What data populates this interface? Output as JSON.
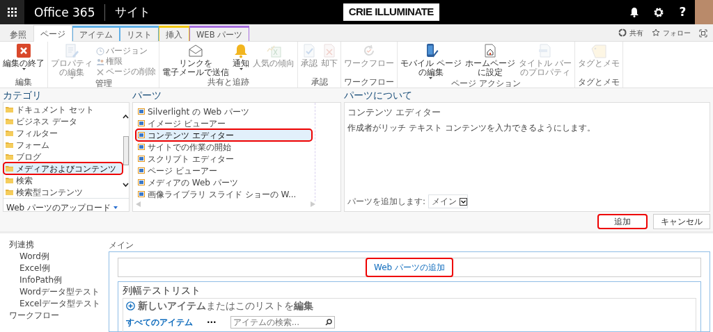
{
  "top_bar": {
    "app_title": "Office 365",
    "site_title": "サイト",
    "logo_text": "CRIE ILLUMINATE",
    "help_label": "?"
  },
  "tabs": [
    {
      "label": "参照",
      "selected": false
    },
    {
      "label": "ページ",
      "selected": true
    },
    {
      "label": "アイテム",
      "selected": false,
      "color": "#5fb0e8"
    },
    {
      "label": "リスト",
      "selected": false,
      "color": "#5fb0e8"
    },
    {
      "label": "挿入",
      "selected": false,
      "color": "#f2c811"
    },
    {
      "label": "WEB パーツ",
      "selected": false,
      "color": "#a86fe0"
    }
  ],
  "page_actions": [
    {
      "label": "共有"
    },
    {
      "label": "フォロー"
    }
  ],
  "ribbon": [
    {
      "label": "編集",
      "buttons": [
        {
          "kind": "large",
          "lines": [
            "編集の終了"
          ],
          "disabled": false,
          "dropdown": true
        }
      ]
    },
    {
      "label": "管理",
      "buttons": [
        {
          "kind": "large",
          "lines": [
            "プロパティ",
            "の編集"
          ],
          "disabled": true,
          "dropdown": true
        },
        {
          "kind": "small",
          "label": "バージョン",
          "disabled": true
        },
        {
          "kind": "small",
          "label": "権限",
          "disabled": true
        },
        {
          "kind": "small",
          "label": "ページの削除",
          "disabled": true
        }
      ]
    },
    {
      "label": "共有と追跡",
      "buttons": [
        {
          "kind": "large",
          "lines": [
            "リンクを",
            "電子メールで送信"
          ],
          "disabled": false
        },
        {
          "kind": "large",
          "lines": [
            "通知"
          ],
          "disabled": false,
          "dropdown": true
        },
        {
          "kind": "large",
          "lines": [
            "人気の傾向"
          ],
          "disabled": true
        }
      ]
    },
    {
      "label": "承認",
      "buttons": [
        {
          "kind": "large",
          "lines": [
            "承認"
          ],
          "disabled": true
        },
        {
          "kind": "large",
          "lines": [
            "却下"
          ],
          "disabled": true
        }
      ]
    },
    {
      "label": "ワークフロー",
      "buttons": [
        {
          "kind": "large",
          "lines": [
            "ワークフロー"
          ],
          "disabled": true
        }
      ]
    },
    {
      "label": "ページ アクション",
      "buttons": [
        {
          "kind": "large",
          "lines": [
            "モバイル ページ",
            "の編集"
          ],
          "disabled": false,
          "dropdown": true
        },
        {
          "kind": "large",
          "lines": [
            "ホームページ",
            "に設定"
          ],
          "disabled": false
        },
        {
          "kind": "large",
          "lines": [
            "タイトル バー",
            "のプロパティ"
          ],
          "disabled": true
        }
      ]
    },
    {
      "label": "タグとメモ",
      "buttons": [
        {
          "kind": "large",
          "lines": [
            "タグとメモ"
          ],
          "disabled": true
        }
      ]
    }
  ],
  "web_part_picker": {
    "categories_heading": "カテゴリ",
    "categories": [
      {
        "label": "ドキュメント セット",
        "selected": false,
        "highlighted": false
      },
      {
        "label": "ビジネス データ",
        "selected": false,
        "highlighted": false
      },
      {
        "label": "フィルター",
        "selected": false,
        "highlighted": false
      },
      {
        "label": "フォーム",
        "selected": false,
        "highlighted": false
      },
      {
        "label": "ブログ",
        "selected": false,
        "highlighted": false
      },
      {
        "label": "メディアおよびコンテンツ",
        "selected": true,
        "highlighted": true
      },
      {
        "label": "検索",
        "selected": false,
        "highlighted": false
      },
      {
        "label": "検索型コンテンツ",
        "selected": false,
        "highlighted": false
      }
    ],
    "upload_link": "Web パーツのアップロード",
    "parts_heading": "パーツ",
    "parts": [
      {
        "label": "Silverlight の Web パーツ",
        "selected": false,
        "highlighted": false
      },
      {
        "label": "イメージ ビューアー",
        "selected": false,
        "highlighted": false
      },
      {
        "label": "コンテンツ エディター",
        "selected": true,
        "highlighted": true
      },
      {
        "label": "サイトでの作業の開始",
        "selected": false,
        "highlighted": false
      },
      {
        "label": "スクリプト エディター",
        "selected": false,
        "highlighted": false
      },
      {
        "label": "ページ ビューアー",
        "selected": false,
        "highlighted": false
      },
      {
        "label": "メディアの Web パーツ",
        "selected": false,
        "highlighted": false
      },
      {
        "label": "画像ライブラリ スライド ショーの W...",
        "selected": false,
        "highlighted": false
      }
    ],
    "about_heading": "パーツについて",
    "about_title": "コンテンツ エディター",
    "about_description": "作成者がリッチ テキスト コンテンツを入力できるようにします。",
    "zone_label": "パーツを追加します:",
    "zone_value": "メイン",
    "add_button": {
      "label": "追加",
      "highlighted": true
    },
    "cancel_button": {
      "label": "キャンセル",
      "highlighted": false
    }
  },
  "quick_launch": [
    {
      "label": "列連携",
      "children": [
        {
          "label": "Word例"
        },
        {
          "label": "Excel例"
        },
        {
          "label": "InfoPath例"
        },
        {
          "label": "Wordデータ型テスト"
        },
        {
          "label": "Excelデータ型テスト"
        }
      ]
    },
    {
      "label": "ワークフロー"
    }
  ],
  "page_zone": {
    "zone_title": "メイン",
    "add_web_part_link": {
      "label": "Web パーツの追加",
      "highlighted": true
    },
    "list_part": {
      "title": "列幅テストリスト",
      "new_item_text": "**新しいアイテム**またはこのリストを**編集**",
      "view_link": "すべてのアイテム",
      "more_label": "···",
      "search_placeholder": "アイテムの検索..."
    }
  }
}
